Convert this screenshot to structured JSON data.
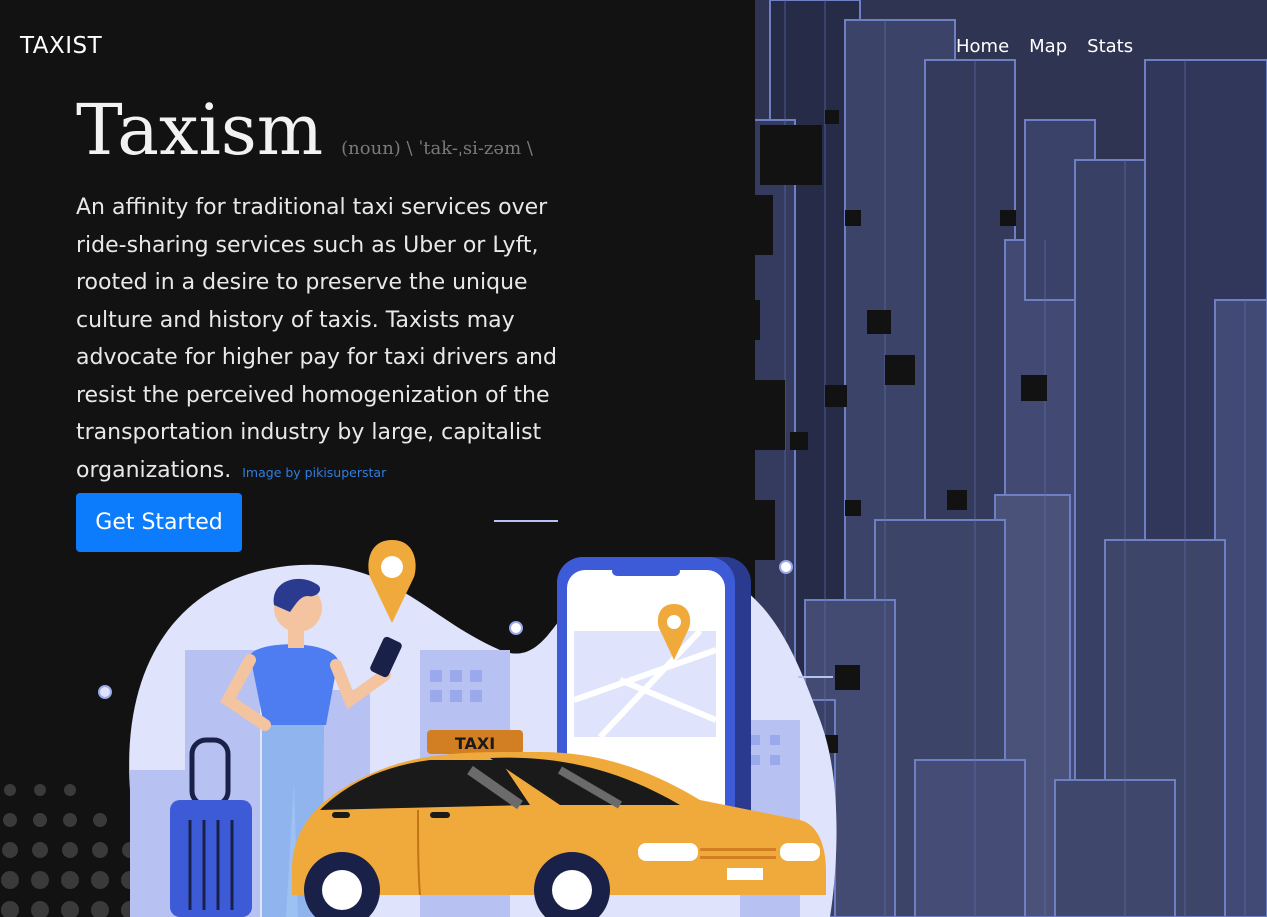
{
  "nav": {
    "brand": "TAXIST",
    "links": [
      {
        "label": "Home"
      },
      {
        "label": "Map"
      },
      {
        "label": "Stats"
      }
    ]
  },
  "hero": {
    "title": "Taxism",
    "pronunciation": "(noun) \\ ˈtak-ˌsi-zəm \\",
    "description": "An affinity for traditional taxi services over ride-sharing services such as Uber or Lyft, rooted in a desire to preserve the unique culture and history of taxis. Taxists may advocate for higher pay for taxi drivers and resist the perceived homogenization of the transportation industry by large, capitalist organizations.",
    "credit": "Image by pikisuperstar",
    "cta_label": "Get Started"
  },
  "illustration": {
    "taxi_sign": "TAXI"
  },
  "colors": {
    "background": "#121212",
    "accent": "#0d7cfc",
    "taxi_yellow": "#f0aa3c",
    "city_blue": "#3a4166"
  }
}
